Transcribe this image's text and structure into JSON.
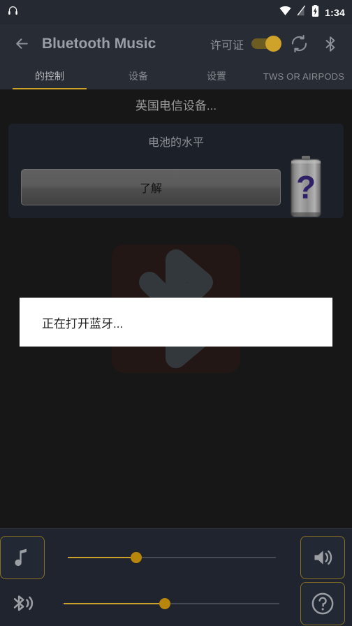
{
  "statusbar": {
    "notification_icon": "headphones-icon",
    "wifi_icon": "wifi-icon",
    "signal_icon": "signal-off-icon",
    "battery_icon": "battery-charging-icon",
    "clock": "1:34"
  },
  "appbar": {
    "back_icon": "back-arrow-icon",
    "title": "Bluetooth Music",
    "license_label": "许可证",
    "license_toggle_on": true,
    "refresh_icon": "refresh-icon",
    "bluetooth_icon": "bluetooth-icon"
  },
  "tabs": [
    {
      "label": "的控制",
      "active": true
    },
    {
      "label": "设备",
      "active": false
    },
    {
      "label": "设置",
      "active": false
    },
    {
      "label": "TWS OR AIRPODS",
      "active": false
    }
  ],
  "device_name": "英国电信设备...",
  "battery_card": {
    "title": "电池的水平",
    "button_label": "了解",
    "battery_icon": "battery-unknown-icon",
    "battery_badge": "?"
  },
  "watermark": {
    "icon": "bluetooth-watermark-icon"
  },
  "dialog": {
    "message": "正在打开蓝牙..."
  },
  "bottom": {
    "music_icon": "music-note-icon",
    "bluetooth_audio_icon": "bluetooth-audio-icon",
    "volume_icon": "speaker-volume-icon",
    "help_icon": "help-circle-icon",
    "media_slider": {
      "name": "media-volume-slider",
      "percent": 33
    },
    "bt_slider": {
      "name": "bluetooth-volume-slider",
      "percent": 47
    }
  },
  "colors": {
    "accent": "#c9a227",
    "appbar_bg": "#282c35",
    "page_bg": "#171717",
    "card_bg": "#1c2028",
    "bottom_bg": "#1f242e",
    "dialog_bg": "#ffffff",
    "battery_badge": "#2f1f66"
  }
}
